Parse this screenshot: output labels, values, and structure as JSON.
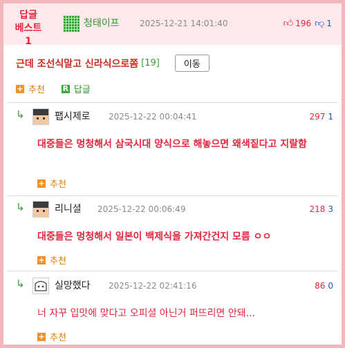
{
  "post": {
    "badge_line1": "답글",
    "badge_line2": "베스트1",
    "author": "청태이프",
    "date": "2025-12-21 14:01:40",
    "upvotes": "196",
    "downvotes": "1",
    "title": "근데 조선식말고 신라식으로쫌",
    "comment_count": "[19]",
    "move_label": "이동",
    "recommend_label": "추천",
    "reply_label": "답글"
  },
  "icons": {
    "reply_arrow": "reply-arrow-icon",
    "thumb_up": "thumbs-up-icon",
    "thumb_down": "thumbs-down-icon",
    "plus": "plus-icon",
    "reply_badge": "R"
  },
  "colors": {
    "accent_red": "#e3263d",
    "accent_green": "#2a9a2a",
    "border_pink": "#f2b6bd",
    "header_bg": "#fde9ec"
  },
  "comments": [
    {
      "name": "팹시제로",
      "date": "2025-12-22 00:04:41",
      "up": "297",
      "down": "1",
      "text": "대중들은 멍청해서 삼국시대 양식으로 해놓으면 왜색짙다고 지랄함",
      "recommend": "추천"
    },
    {
      "name": "리니셜",
      "date": "2025-12-22 00:06:49",
      "up": "218",
      "down": "3",
      "text": "대중들은 멍청해서 일본이 백제식을 가져간건지 모름 ㅇㅇ",
      "recommend": "추천"
    },
    {
      "name": "실망했다",
      "date": "2025-12-22 02:41:16",
      "up": "86",
      "down": "0",
      "text": "너 자꾸 입맛에 맞다고 오피셜 아닌거 퍼뜨리면 안돼...",
      "recommend": "추천"
    }
  ]
}
